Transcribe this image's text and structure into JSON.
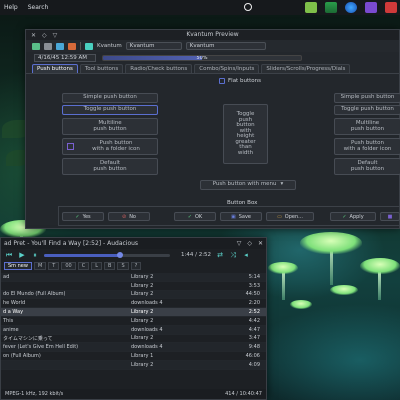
{
  "top_panel": {
    "menu": [
      "Help",
      "Search"
    ],
    "tray_icons": [
      "folder-icon",
      "chart-icon",
      "browser-icon",
      "purple-app-icon",
      "red-app-icon"
    ]
  },
  "kvantum": {
    "title": "Kvantum Preview",
    "toolbar_combo1": "Kvantum",
    "toolbar_combo2": "Kvantum",
    "date": "4/16/45 12:59 AM",
    "progress_percent": 50,
    "progress_text": "50%",
    "tabs": [
      "Push buttons",
      "Tool buttons",
      "Radio/Check buttons",
      "Combo/Spins/Inputs",
      "Sliders/Scrolls/Progress/Dials"
    ],
    "flat_buttons_label": "Flat buttons",
    "buttons": {
      "simple": "Simple push button",
      "toggle": "Toggle push button",
      "multiline": "Multiline\npush button",
      "folder": "Push button\nwith a folder icon",
      "default": "Default\npush button",
      "tall": "Toggle\npush\nbutton\nwith\nheight\ngreater\nthan\nwidth",
      "menu": "Push button with menu"
    },
    "button_box_label": "Button Box",
    "button_box": [
      "Yes",
      "No",
      "OK",
      "Save",
      "Open...",
      "Apply"
    ]
  },
  "audacious": {
    "title": "ad Pret - You'll Find a Way [2:52] - Audacious",
    "time": "1:44 / 2:52",
    "tabs": [
      "Sm new",
      "M",
      "T",
      "00",
      "C",
      "L",
      "B",
      "S",
      "?"
    ],
    "rows": [
      {
        "title": "ad",
        "album": "Library 2",
        "length": "5:14"
      },
      {
        "title": "",
        "album": "Library 2",
        "length": "3:53"
      },
      {
        "title": "do El Mundo (Full Album)",
        "album": "Library 2",
        "length": "44:50"
      },
      {
        "title": "he World",
        "album": "downloads 4",
        "length": "2:20"
      },
      {
        "title": "d a Way",
        "album": "Library 2",
        "length": "2:52"
      },
      {
        "title": "This",
        "album": "Library 2",
        "length": "4:42"
      },
      {
        "title": "anime",
        "album": "downloads 4",
        "length": "4:47"
      },
      {
        "title": "タイムマシンに乗って",
        "album": "Library 2",
        "length": "3:47"
      },
      {
        "title": "fever (Let's Give Em Hell Edit)",
        "album": "downloads 4",
        "length": "9:48"
      },
      {
        "title": "on (Full Album)",
        "album": "Library 1",
        "length": "46:06"
      },
      {
        "title": "",
        "album": "Library 2",
        "length": "4:09"
      }
    ],
    "status_left": "MPEG-1 kHz, 192 kbit/s",
    "status_right": "414 / 10:40:47"
  }
}
